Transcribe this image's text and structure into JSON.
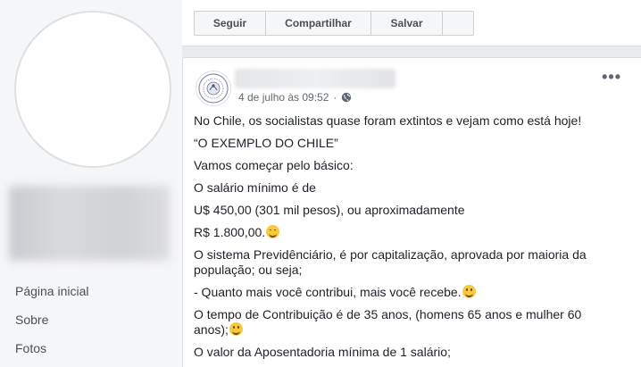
{
  "sidebar": {
    "nav_items": [
      {
        "label": "Página inicial"
      },
      {
        "label": "Sobre"
      },
      {
        "label": "Fotos"
      }
    ]
  },
  "action_bar": {
    "follow_label": "Seguir",
    "share_label": "Compartilhar",
    "save_label": "Salvar"
  },
  "post": {
    "timestamp": "4 de julho às 09:52",
    "separator": "·",
    "privacy_icon": "globe-icon",
    "options_icon": "more-horizontal-icon",
    "options_label": "•••",
    "lines": [
      "No Chile, os socialistas quase foram extintos e vejam como está hoje!",
      "“O EXEMPLO DO CHILE”",
      "Vamos começar pelo básico:",
      "O salário mínimo é de",
      "U$ 450,00 (301 mil pesos), ou aproximadamente",
      "R$ 1.800,00.",
      "O sistema Previdênciário, é por capitalização, aprovada por maioria da população; ou seja;",
      "- Quanto mais você contribui, mais você recebe.",
      "O tempo de Contribuição é de 35 anos, (homens 65 anos e mulher 60 anos);",
      "O valor da Aposentadoria mínima de 1 salário;"
    ]
  },
  "colors": {
    "page_bg": "#e9ebee",
    "card_bg": "#ffffff",
    "text": "#1d2129",
    "muted": "#606770",
    "emoji": "#f7c93e"
  }
}
